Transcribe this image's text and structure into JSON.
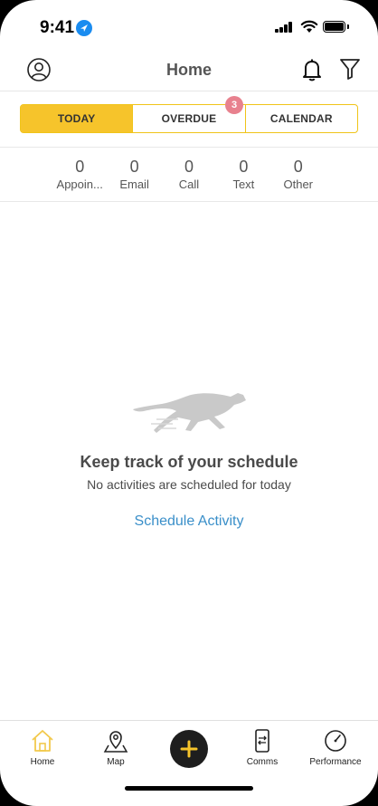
{
  "status_bar": {
    "time": "9:41"
  },
  "header": {
    "title": "Home"
  },
  "tabs": [
    {
      "label": "TODAY",
      "active": true
    },
    {
      "label": "OVERDUE",
      "badge": "3"
    },
    {
      "label": "CALENDAR"
    }
  ],
  "counts": [
    {
      "value": "0",
      "label": "Appoin..."
    },
    {
      "value": "0",
      "label": "Email"
    },
    {
      "value": "0",
      "label": "Call"
    },
    {
      "value": "0",
      "label": "Text"
    },
    {
      "value": "0",
      "label": "Other"
    }
  ],
  "empty_state": {
    "title": "Keep track of your schedule",
    "subtitle": "No activities are scheduled for today",
    "action": "Schedule Activity"
  },
  "bottom_nav": [
    {
      "label": "Home",
      "icon": "home-icon"
    },
    {
      "label": "Map",
      "icon": "map-pin-icon"
    },
    {
      "label": "",
      "icon": "plus-icon"
    },
    {
      "label": "Comms",
      "icon": "phone-transfer-icon"
    },
    {
      "label": "Performance",
      "icon": "gauge-icon"
    }
  ],
  "colors": {
    "accent": "#F6C42B",
    "link": "#3A8FC9",
    "badge": "#E8818E",
    "home_icon": "#F2C94C"
  }
}
